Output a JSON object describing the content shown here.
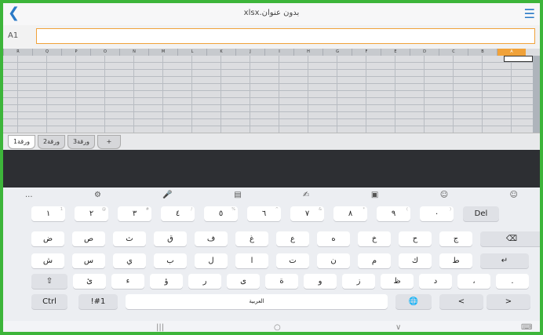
{
  "title": "بدون عنوان.xlsx",
  "cell_ref": "A1",
  "formula_value": "",
  "columns": [
    "A",
    "B",
    "C",
    "D",
    "E",
    "F",
    "G",
    "H",
    "I",
    "J",
    "K",
    "L",
    "M",
    "N",
    "O",
    "P",
    "Q",
    "R"
  ],
  "sheets": [
    "ورقة1",
    "ورقة2",
    "ورقة3"
  ],
  "add_sheet": "+",
  "toolbar": [
    "...",
    "⚙",
    "🎤",
    "▤",
    "✍",
    "▣",
    "☺",
    "☺"
  ],
  "rows": [
    [
      {
        "k": "١",
        "h": "1"
      },
      {
        "k": "٢",
        "h": "@"
      },
      {
        "k": "٣",
        "h": "#"
      },
      {
        "k": "٤",
        "h": "/"
      },
      {
        "k": "٥",
        "h": "%"
      },
      {
        "k": "٦",
        "h": "^"
      },
      {
        "k": "٧",
        "h": "&"
      },
      {
        "k": "٨",
        "h": "*"
      },
      {
        "k": "٩",
        "h": "("
      },
      {
        "k": "٠",
        "h": ")"
      },
      {
        "k": "Del",
        "h": ""
      }
    ],
    [
      {
        "k": "ض",
        "h": ""
      },
      {
        "k": "ص",
        "h": ""
      },
      {
        "k": "ث",
        "h": ""
      },
      {
        "k": "ق",
        "h": ""
      },
      {
        "k": "ف",
        "h": ""
      },
      {
        "k": "غ",
        "h": ""
      },
      {
        "k": "ع",
        "h": ""
      },
      {
        "k": "ه",
        "h": ""
      },
      {
        "k": "خ",
        "h": ""
      },
      {
        "k": "ح",
        "h": ""
      },
      {
        "k": "ج",
        "h": ""
      },
      {
        "k": "⌫",
        "h": ""
      }
    ],
    [
      {
        "k": "ش",
        "h": ""
      },
      {
        "k": "س",
        "h": ""
      },
      {
        "k": "ي",
        "h": ""
      },
      {
        "k": "ب",
        "h": ""
      },
      {
        "k": "ل",
        "h": ""
      },
      {
        "k": "ا",
        "h": ""
      },
      {
        "k": "ت",
        "h": ""
      },
      {
        "k": "ن",
        "h": ""
      },
      {
        "k": "م",
        "h": ""
      },
      {
        "k": "ك",
        "h": ""
      },
      {
        "k": "ط",
        "h": ""
      },
      {
        "k": "↵",
        "h": ""
      }
    ],
    [
      {
        "k": "⇧",
        "h": ""
      },
      {
        "k": "ئ",
        "h": ""
      },
      {
        "k": "ء",
        "h": ""
      },
      {
        "k": "ؤ",
        "h": ""
      },
      {
        "k": "ر",
        "h": ""
      },
      {
        "k": "ى",
        "h": ""
      },
      {
        "k": "ة",
        "h": ""
      },
      {
        "k": "و",
        "h": ""
      },
      {
        "k": "ز",
        "h": ""
      },
      {
        "k": "ظ",
        "h": ""
      },
      {
        "k": "د",
        "h": ""
      },
      {
        "k": "،",
        "h": ""
      },
      {
        "k": ".",
        "h": ""
      }
    ],
    [
      {
        "k": "Ctrl",
        "h": ""
      },
      {
        "k": "!#1",
        "h": ""
      },
      {
        "k": "العربية",
        "h": ""
      },
      {
        "k": "🌐",
        "h": ""
      },
      {
        "k": "<",
        "h": ""
      },
      {
        "k": ">",
        "h": ""
      }
    ]
  ],
  "nav": [
    "|||",
    "○",
    "∨",
    "⌨"
  ]
}
